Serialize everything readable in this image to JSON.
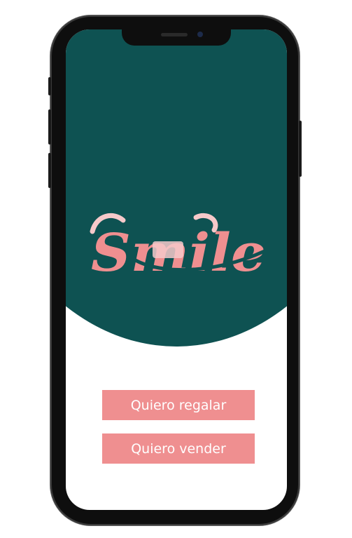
{
  "app": {
    "logo_text": "Smile",
    "logo_icon": "smile-logo-icon"
  },
  "colors": {
    "primary": "#0e5252",
    "accent": "#ef8f90",
    "accent_light": "#f6c9ca"
  },
  "actions": {
    "gift_label": "Quiero regalar",
    "sell_label": "Quiero vender"
  }
}
